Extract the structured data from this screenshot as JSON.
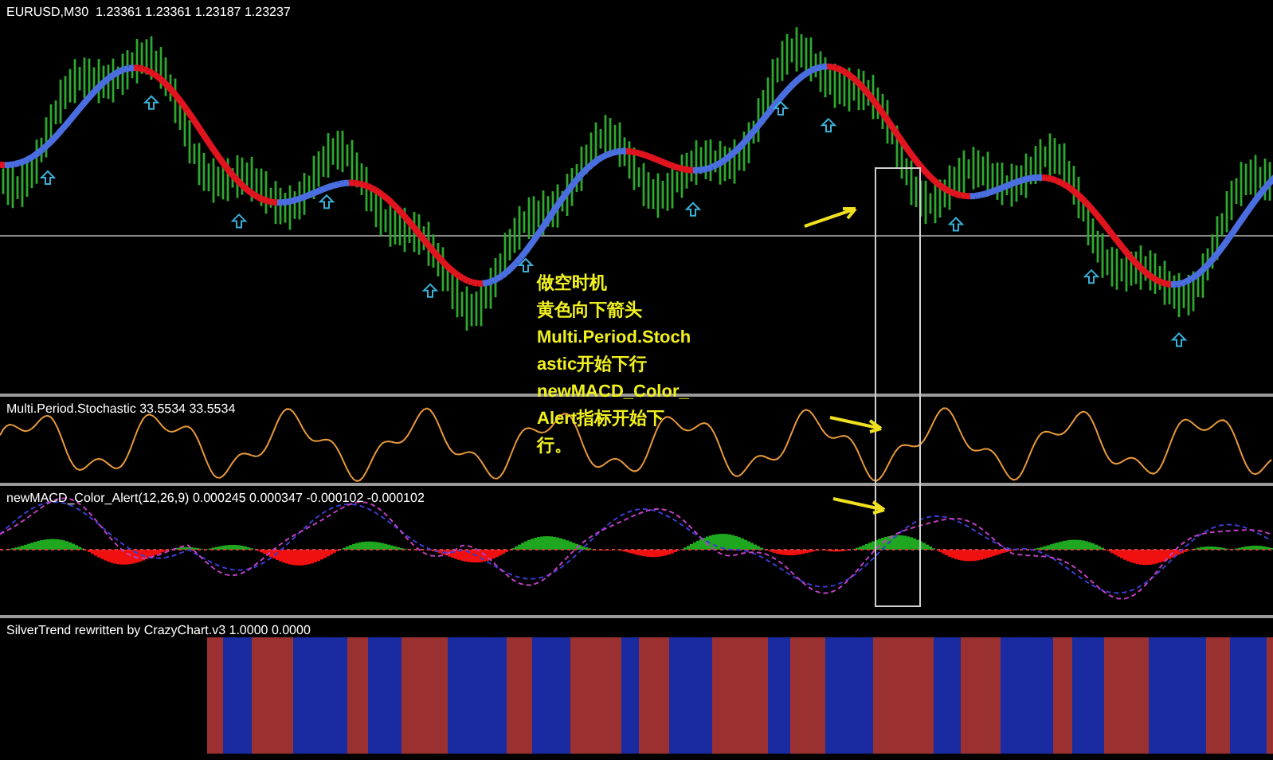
{
  "main_chart": {
    "symbol": "EURUSD,M30",
    "prices": "1.23361 1.23361 1.23187 1.23237"
  },
  "annotation": {
    "lines": [
      "做空时机",
      "黄色向下箭头",
      "Multi.Period.Stoch",
      "astic开始下行",
      "newMACD_Color_",
      "Alert指标开始下",
      "行。"
    ]
  },
  "panels": [
    {
      "kind": "stochastic",
      "label": "Multi.Period.Stochastic 33.5534 33.5534"
    },
    {
      "kind": "macd",
      "label": "newMACD_Color_Alert(12,26,9) 0.000245 0.000347 -0.000102 -0.000102"
    },
    {
      "kind": "silvertrend",
      "label": "SilverTrend rewritten by CrazyChart.v3 1.0000 0.0000"
    }
  ]
}
